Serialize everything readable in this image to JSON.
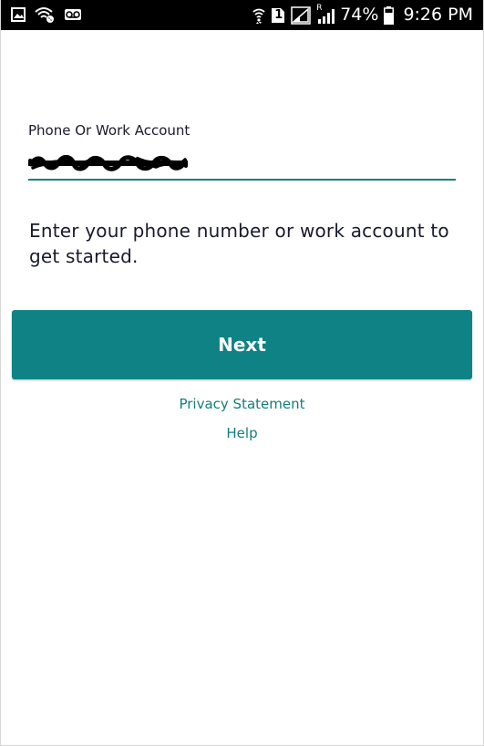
{
  "status_bar": {
    "battery_percent": "74%",
    "time": "9:26 PM",
    "sim_slot": "1",
    "roaming_indicator": "R",
    "left_icons": [
      "gallery-icon",
      "wifi-calling-icon",
      "voicemail-icon"
    ],
    "right_icons": [
      "wifi-icon",
      "sim-1-icon",
      "signal-icon",
      "signal-roaming-icon",
      "battery-icon"
    ],
    "battery_level": 0.74
  },
  "form": {
    "field_label": "Phone Or Work Account",
    "phone_value": "(***) ***-****",
    "phone_value_redacted": true,
    "instruction": "Enter your phone number or work account to get started."
  },
  "actions": {
    "next_label": "Next",
    "privacy_label": "Privacy Statement",
    "help_label": "Help"
  },
  "colors": {
    "accent": "#0e8284",
    "link": "#137d7c",
    "underline": "#16807f",
    "text": "#1a1a2e",
    "status_bar": "#000000"
  }
}
